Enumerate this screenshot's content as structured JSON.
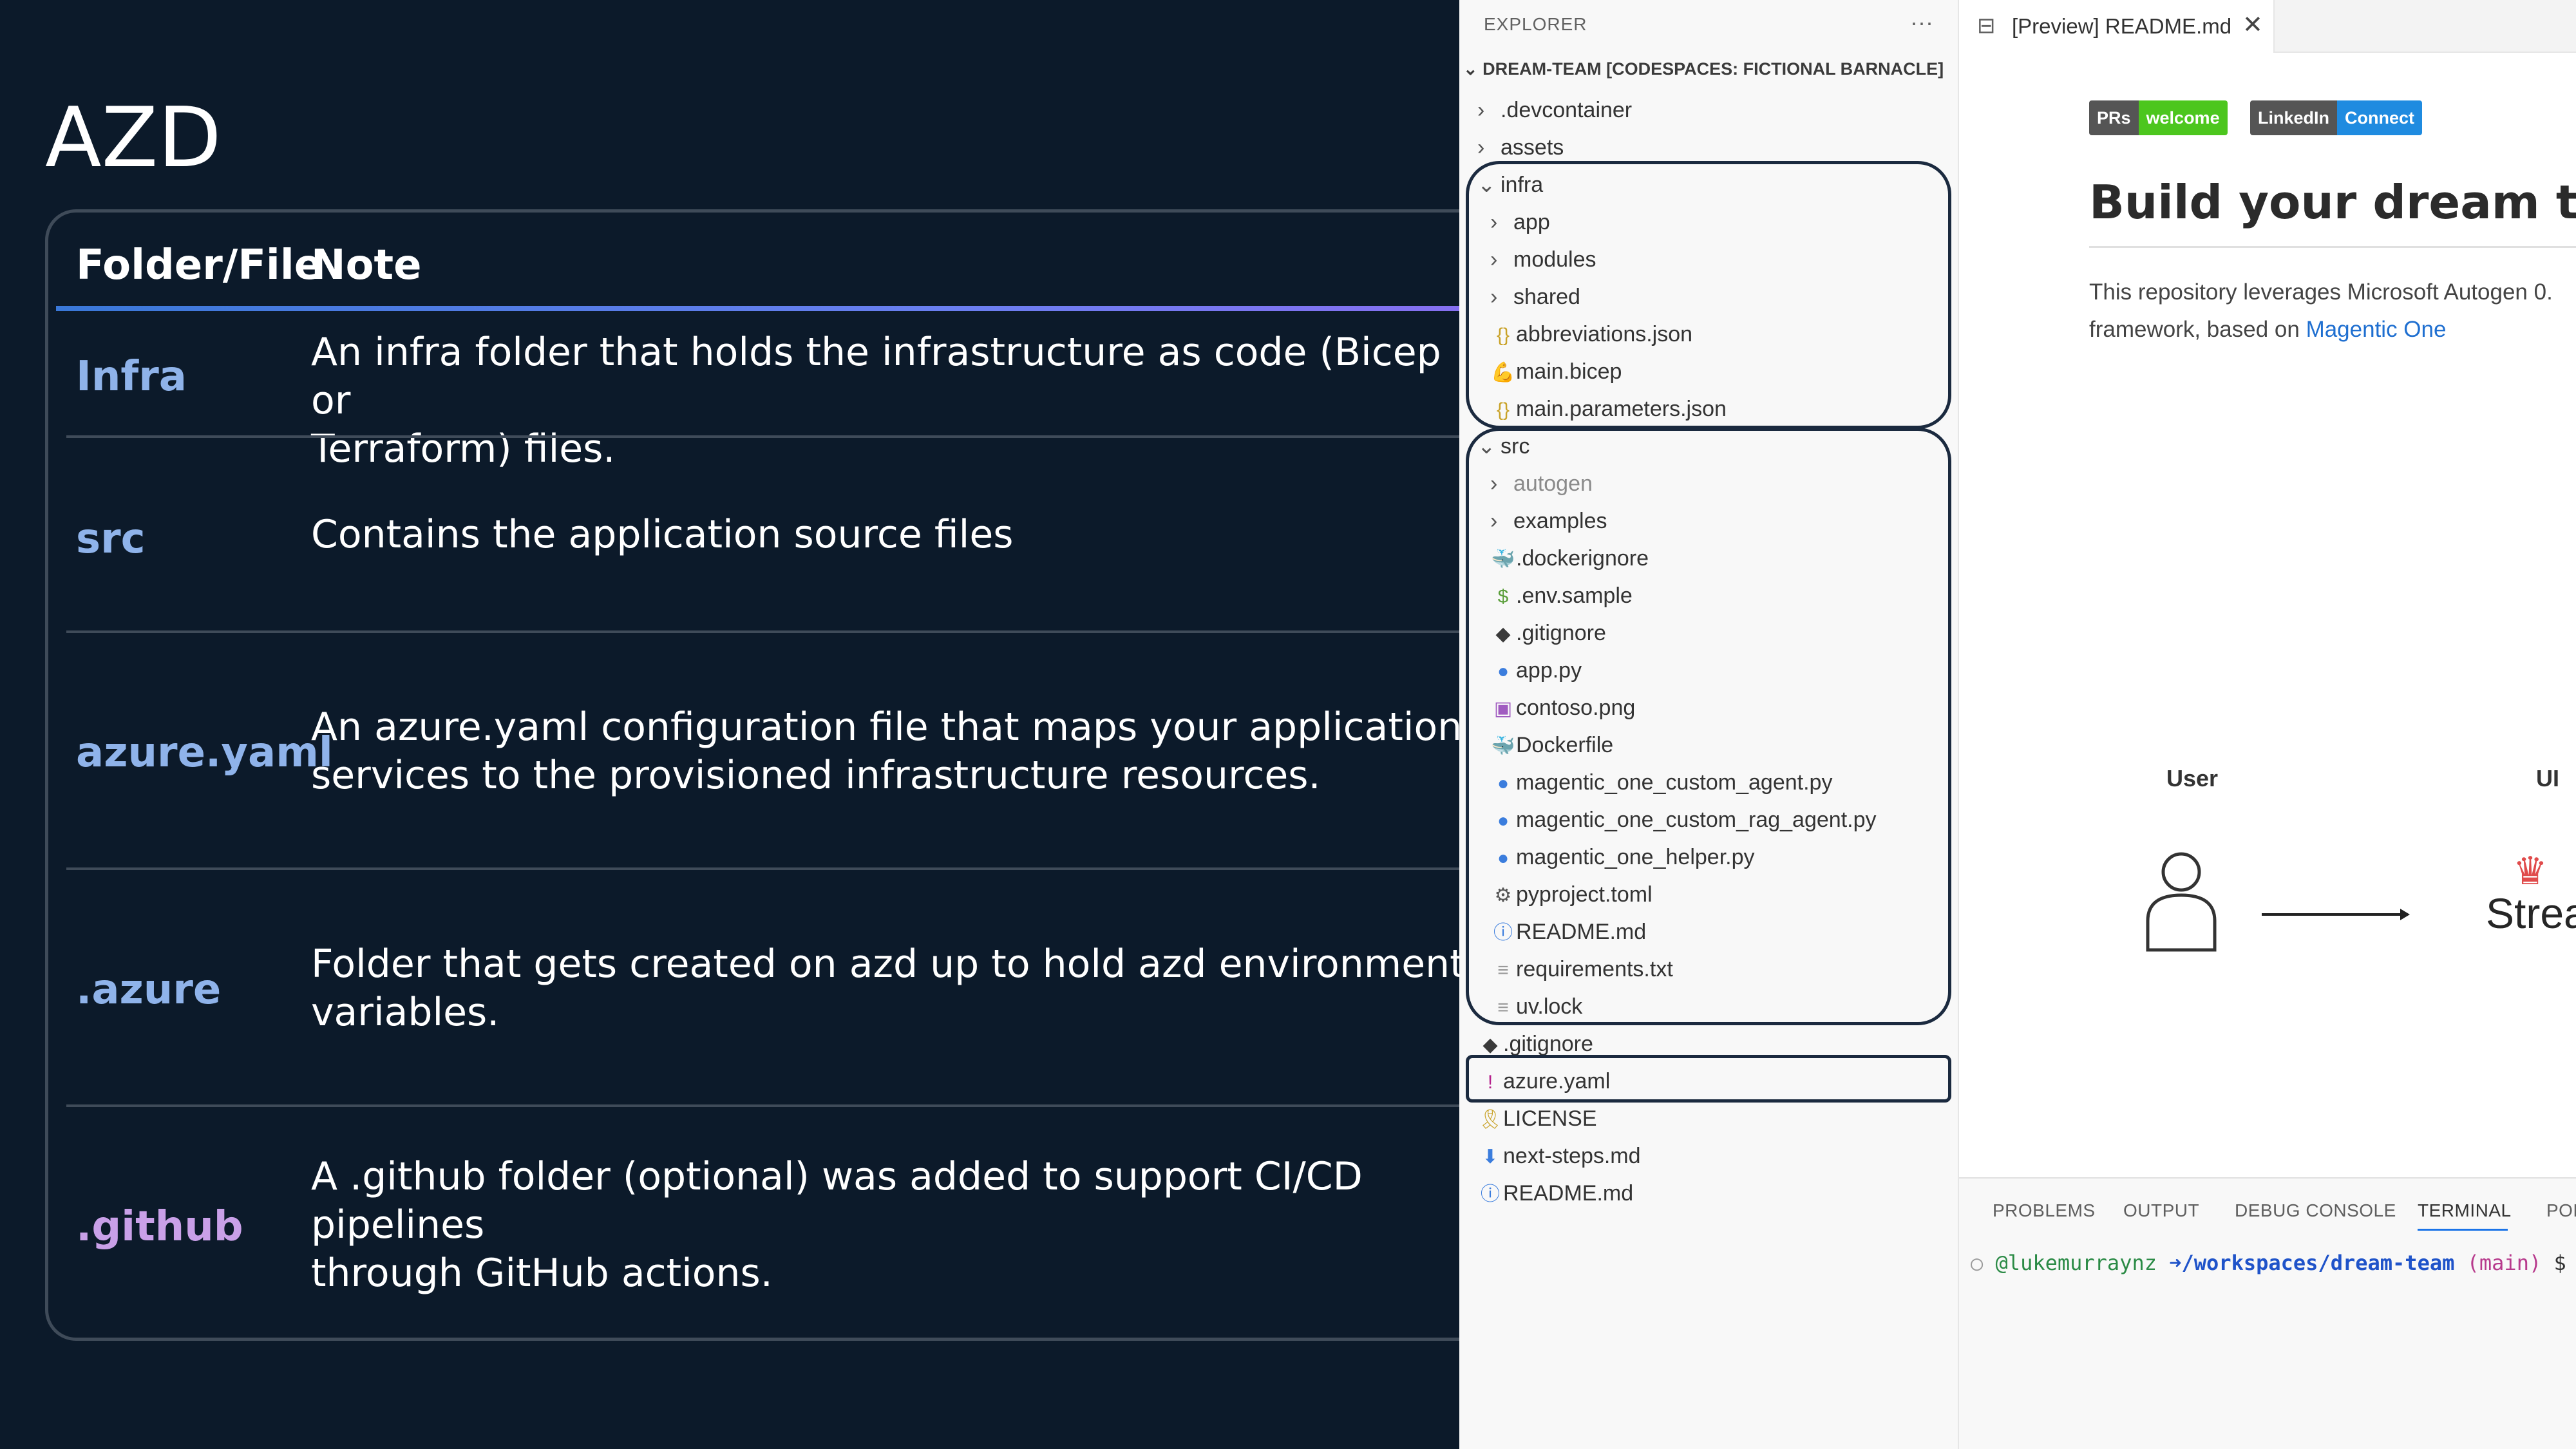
{
  "slide": {
    "title": "AZD",
    "table": {
      "headers": [
        "Folder/File",
        "Note"
      ],
      "rows": [
        {
          "key": "Infra",
          "note_lines": [
            "An infra folder that holds the infrastructure as code (Bicep or",
            "Terraform) files."
          ],
          "key_color": "#8fb3ea"
        },
        {
          "key": "src",
          "note_lines": [
            "Contains the application source files"
          ],
          "key_color": "#8fb3ea"
        },
        {
          "key": "azure.yaml",
          "note_lines": [
            "An azure.yaml configuration file that maps your application",
            "services to the provisioned infrastructure resources."
          ],
          "key_color": "#8fb3ea"
        },
        {
          "key": ".azure",
          "note_lines": [
            "Folder that gets created on azd up to hold azd environment",
            "variables."
          ],
          "key_color": "#8fb3ea"
        },
        {
          "key": ".github",
          "note_lines": [
            "A .github folder (optional) was added to support CI/CD pipelines",
            "through GitHub actions."
          ],
          "key_color": "#c9a0e8"
        }
      ]
    }
  },
  "explorer": {
    "header": "EXPLORER",
    "more_icon": "ellipsis-icon",
    "workspace": "DREAM-TEAM [CODESPACES: FICTIONAL BARNACLE]",
    "items": [
      {
        "label": ".devcontainer",
        "kind": "folder",
        "expanded": false,
        "depth": 1,
        "icon": "chevron-right-icon"
      },
      {
        "label": "assets",
        "kind": "folder",
        "expanded": false,
        "depth": 1,
        "icon": "chevron-right-icon"
      },
      {
        "label": "infra",
        "kind": "folder",
        "expanded": true,
        "depth": 1,
        "icon": "chevron-down-icon"
      },
      {
        "label": "app",
        "kind": "folder",
        "expanded": false,
        "depth": 2,
        "icon": "chevron-right-icon"
      },
      {
        "label": "modules",
        "kind": "folder",
        "expanded": false,
        "depth": 2,
        "icon": "chevron-right-icon"
      },
      {
        "label": "shared",
        "kind": "folder",
        "expanded": false,
        "depth": 2,
        "icon": "chevron-right-icon"
      },
      {
        "label": "abbreviations.json",
        "kind": "file",
        "depth": 2,
        "icon": "json-icon",
        "glyph": "{}",
        "color": "#c9a227"
      },
      {
        "label": "main.bicep",
        "kind": "file",
        "depth": 2,
        "icon": "bicep-icon",
        "glyph": "💪",
        "color": "#3b7ddd"
      },
      {
        "label": "main.parameters.json",
        "kind": "file",
        "depth": 2,
        "icon": "json-icon",
        "glyph": "{}",
        "color": "#c9a227"
      },
      {
        "label": "src",
        "kind": "folder",
        "expanded": true,
        "depth": 1,
        "icon": "chevron-down-icon"
      },
      {
        "label": "autogen",
        "kind": "folder",
        "expanded": false,
        "depth": 2,
        "icon": "chevron-right-icon",
        "muted": true
      },
      {
        "label": "examples",
        "kind": "folder",
        "expanded": false,
        "depth": 2,
        "icon": "chevron-right-icon"
      },
      {
        "label": ".dockerignore",
        "kind": "file",
        "depth": 2,
        "icon": "docker-icon",
        "glyph": "🐳",
        "color": "#3a3a3a"
      },
      {
        "label": ".env.sample",
        "kind": "file",
        "depth": 2,
        "icon": "dollar-icon",
        "glyph": "$",
        "color": "#5a9e3a"
      },
      {
        "label": ".gitignore",
        "kind": "file",
        "depth": 2,
        "icon": "git-icon",
        "glyph": "◆",
        "color": "#3a3a3a"
      },
      {
        "label": "app.py",
        "kind": "file",
        "depth": 2,
        "icon": "python-icon",
        "glyph": "●",
        "color": "#3b7ddd"
      },
      {
        "label": "contoso.png",
        "kind": "file",
        "depth": 2,
        "icon": "image-icon",
        "glyph": "▣",
        "color": "#a05ac0"
      },
      {
        "label": "Dockerfile",
        "kind": "file",
        "depth": 2,
        "icon": "docker-icon",
        "glyph": "🐳",
        "color": "#3b7ddd"
      },
      {
        "label": "magentic_one_custom_agent.py",
        "kind": "file",
        "depth": 2,
        "icon": "python-icon",
        "glyph": "●",
        "color": "#3b7ddd"
      },
      {
        "label": "magentic_one_custom_rag_agent.py",
        "kind": "file",
        "depth": 2,
        "icon": "python-icon",
        "glyph": "●",
        "color": "#3b7ddd"
      },
      {
        "label": "magentic_one_helper.py",
        "kind": "file",
        "depth": 2,
        "icon": "python-icon",
        "glyph": "●",
        "color": "#3b7ddd"
      },
      {
        "label": "pyproject.toml",
        "kind": "file",
        "depth": 2,
        "icon": "gear-icon",
        "glyph": "⚙",
        "color": "#555555"
      },
      {
        "label": "README.md",
        "kind": "file",
        "depth": 2,
        "icon": "info-icon",
        "glyph": "ⓘ",
        "color": "#3b7ddd"
      },
      {
        "label": "requirements.txt",
        "kind": "file",
        "depth": 2,
        "icon": "text-file-icon",
        "glyph": "≡",
        "color": "#9a9a9a"
      },
      {
        "label": "uv.lock",
        "kind": "file",
        "depth": 2,
        "icon": "text-file-icon",
        "glyph": "≡",
        "color": "#9a9a9a"
      },
      {
        "label": ".gitignore",
        "kind": "file",
        "depth": 1,
        "icon": "git-icon",
        "glyph": "◆",
        "color": "#3a3a3a"
      },
      {
        "label": "azure.yaml",
        "kind": "file",
        "depth": 1,
        "icon": "yaml-icon",
        "glyph": "!",
        "color": "#b5218c"
      },
      {
        "label": "LICENSE",
        "kind": "file",
        "depth": 1,
        "icon": "license-icon",
        "glyph": "🎗",
        "color": "#c9a227"
      },
      {
        "label": "next-steps.md",
        "kind": "file",
        "depth": 1,
        "icon": "download-icon",
        "glyph": "⬇",
        "color": "#3b7ddd"
      },
      {
        "label": "README.md",
        "kind": "file",
        "depth": 1,
        "icon": "info-icon",
        "glyph": "ⓘ",
        "color": "#3b7ddd"
      }
    ]
  },
  "editor": {
    "tab": {
      "label": "[Preview] README.md",
      "icon": "preview-icon",
      "close_icon": "close-icon"
    },
    "badges": [
      {
        "left": "PRs",
        "right": "welcome",
        "right_color": "#4cc61e"
      },
      {
        "left": "LinkedIn",
        "right": "Connect",
        "right_color": "#1f8be0"
      }
    ],
    "heading": "Build your dream team",
    "para_line1": "This repository leverages Microsoft Autogen 0.",
    "para_line2_prefix": "framework, based on ",
    "para_link": "Magentic One",
    "diagram": {
      "user_label": "User",
      "ui_label": "UI",
      "ui_text": "Stream"
    }
  },
  "panel": {
    "tabs": [
      "PROBLEMS",
      "OUTPUT",
      "DEBUG CONSOLE",
      "TERMINAL",
      "POF"
    ],
    "active_tab": "TERMINAL",
    "terminal": {
      "user": "@lukemurraynz",
      "arrow": "➜",
      "path": "/workspaces/dream-team",
      "branch": "(main)",
      "prompt": "$"
    }
  }
}
